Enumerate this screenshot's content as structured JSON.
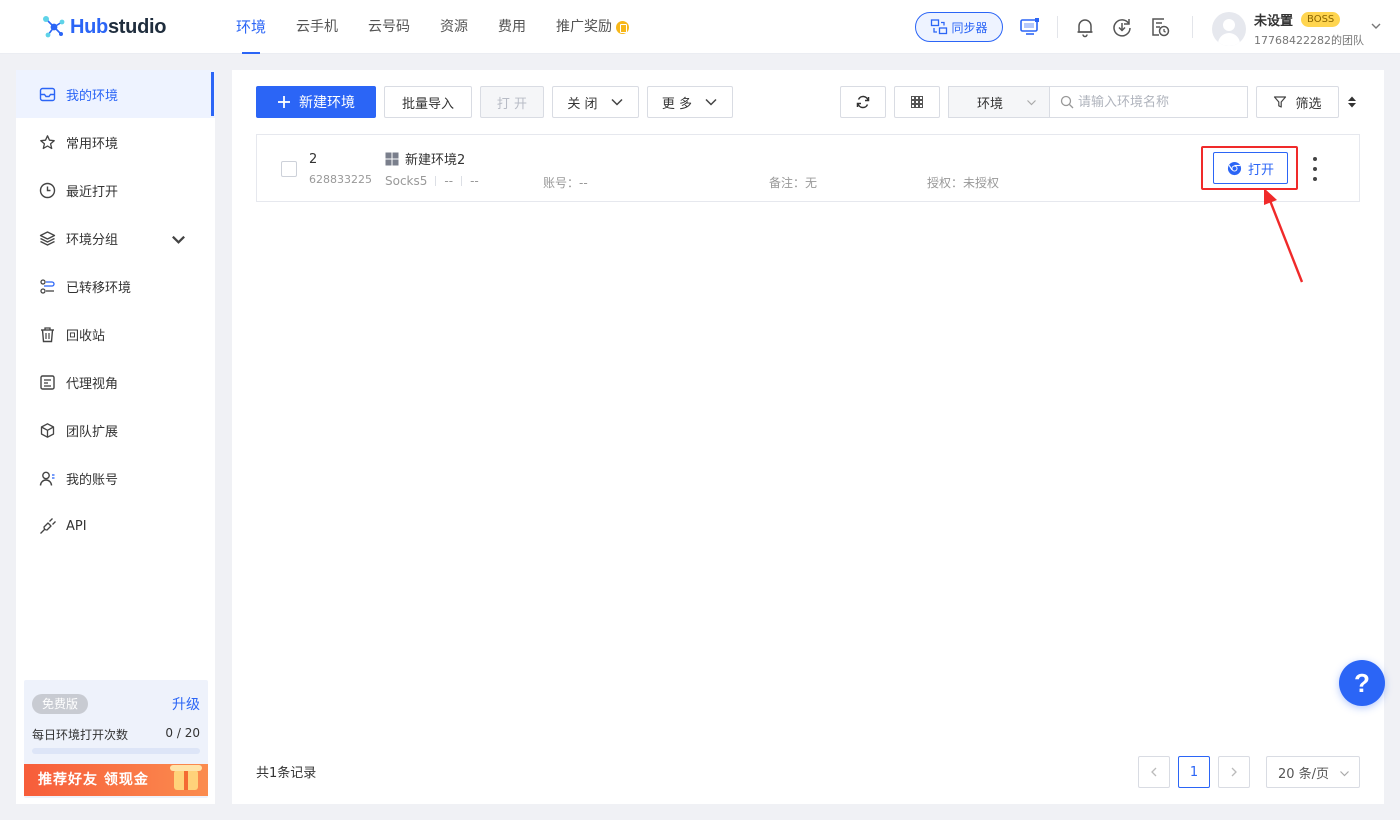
{
  "brand": {
    "logo_prefix": "Hub",
    "logo_suffix": "studio"
  },
  "topnav": {
    "items": [
      {
        "label": "环境",
        "active": true
      },
      {
        "label": "云手机"
      },
      {
        "label": "云号码"
      },
      {
        "label": "资源"
      },
      {
        "label": "费用"
      },
      {
        "label": "推广奖励"
      }
    ],
    "sync_label": "同步器"
  },
  "user": {
    "name": "未设置",
    "role_badge": "BOSS",
    "team": "17768422282的团队"
  },
  "sidebar": {
    "items": [
      {
        "label": "我的环境",
        "icon": "my-env-icon",
        "active": true
      },
      {
        "label": "常用环境",
        "icon": "star-icon"
      },
      {
        "label": "最近打开",
        "icon": "clock-icon"
      },
      {
        "label": "环境分组",
        "icon": "layers-icon",
        "expandable": true
      },
      {
        "label": "已转移环境",
        "icon": "transfer-icon"
      },
      {
        "label": "回收站",
        "icon": "trash-icon"
      },
      {
        "label": "代理视角",
        "icon": "proxy-view-icon"
      },
      {
        "label": "团队扩展",
        "icon": "cube-icon"
      },
      {
        "label": "我的账号",
        "icon": "account-icon"
      },
      {
        "label": "API",
        "icon": "api-plug-icon"
      }
    ],
    "plan": {
      "badge": "免费版",
      "upgrade_label": "升级",
      "quota_label": "每日环境打开次数",
      "quota_value": "0 / 20",
      "quota_used_fraction": 0
    },
    "promo_label": "推荐好友 领现金"
  },
  "toolbar": {
    "new_env_label": "新建环境",
    "batch_import_label": "批量导入",
    "open_label": "打 开",
    "close_label": "关 闭",
    "more_label": "更 多",
    "search_type": "环境",
    "search_placeholder": "请输入环境名称",
    "filter_label": "筛选"
  },
  "environments": [
    {
      "index": "2",
      "id": "628833225",
      "name": "新建环境2",
      "proxy_type": "Socks5",
      "proxy_field1": "--",
      "proxy_field2": "--",
      "account": "账号：--",
      "note": "备注：无",
      "auth": "授权：未授权",
      "open_label": "打开"
    }
  ],
  "pagination": {
    "total_text": "共1条记录",
    "current_page": "1",
    "page_size": "20 条/页"
  },
  "help_label": "?",
  "colors": {
    "primary": "#2b65f6",
    "highlight": "#f02a2a",
    "boss_badge": "#ffd54f"
  }
}
